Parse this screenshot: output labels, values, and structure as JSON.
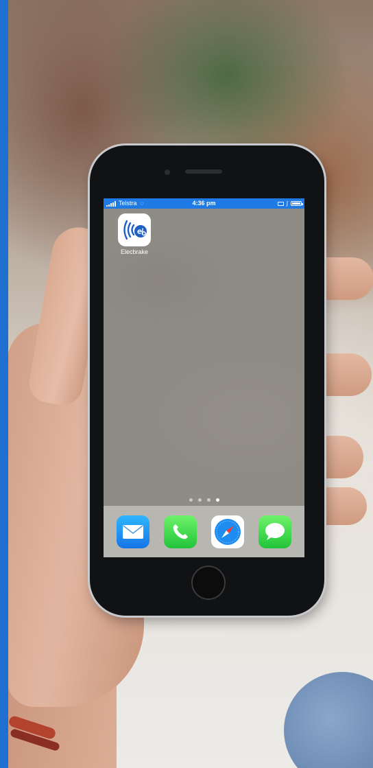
{
  "status_bar": {
    "carrier": "Telstra",
    "time": "4:36 pm"
  },
  "home_screen": {
    "apps": [
      {
        "label": "Elecbrake",
        "icon": "elecbrake-app-icon"
      }
    ],
    "page_indicator": {
      "pages": 4,
      "current": 4
    },
    "dock": [
      {
        "icon": "mail-icon"
      },
      {
        "icon": "phone-icon"
      },
      {
        "icon": "safari-icon"
      },
      {
        "icon": "messages-icon"
      }
    ]
  },
  "colors": {
    "accent_bar": "#1f6fd1",
    "status_bar": "#1f7ae6",
    "elecbrake_blue": "#1f5fc4"
  }
}
